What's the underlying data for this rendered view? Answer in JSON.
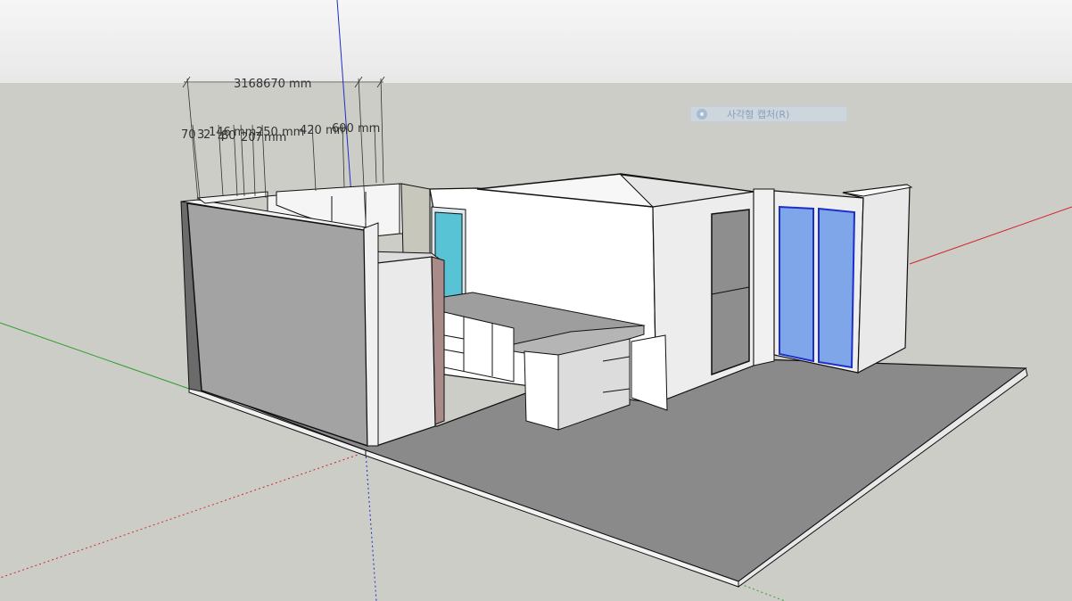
{
  "scene": {
    "ground_color": "#cdcdc8",
    "sky_color": "#efefef",
    "axis_colors": {
      "red": "#d2232a",
      "green": "#2ca02c",
      "blue": "#1c2fc8"
    }
  },
  "dimensions": {
    "top_overall": "3168670 mm",
    "row_labels": {
      "d1": "70",
      "d2": "3",
      "d3": "2",
      "d4": "146",
      "d5": "4",
      "d6": "80",
      "d7": "mm",
      "d8": "20",
      "d9": "7",
      "d10": "mm",
      "d11": "250 mm",
      "d12": "420 mm",
      "d13": "600 mm"
    }
  },
  "tooltip": {
    "icon": "capture-icon",
    "label": "사각형 캡처(R)"
  }
}
